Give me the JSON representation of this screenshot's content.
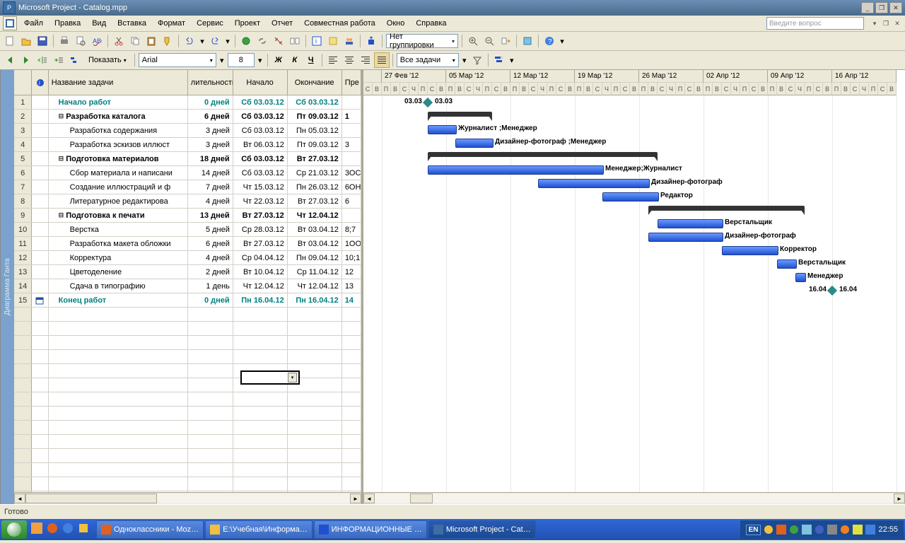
{
  "window": {
    "title": "Microsoft Project - Catalog.mpp"
  },
  "menu": {
    "items": [
      "Файл",
      "Правка",
      "Вид",
      "Вставка",
      "Формат",
      "Сервис",
      "Проект",
      "Отчет",
      "Совместная работа",
      "Окно",
      "Справка"
    ],
    "question": "Введите вопрос"
  },
  "toolbar": {
    "group_combo": "Нет группировки"
  },
  "toolbar2": {
    "show": "Показать",
    "font": "Arial",
    "size": "8",
    "filter": "Все задачи"
  },
  "grid": {
    "headers": [
      "",
      "",
      "Название задачи",
      "лительность",
      "Начало",
      "Окончание",
      "Пре"
    ],
    "rows": [
      {
        "n": "1",
        "ic": "",
        "name": "Начало работ",
        "dur": "0 дней",
        "start": "Сб 03.03.12",
        "end": "Сб 03.03.12",
        "pred": "",
        "bold": true,
        "teal": true,
        "indent": 1
      },
      {
        "n": "2",
        "ic": "",
        "name": "Разработка каталога",
        "dur": "6 дней",
        "start": "Сб 03.03.12",
        "end": "Пт 09.03.12",
        "pred": "1",
        "bold": true,
        "indent": 1,
        "outline": true
      },
      {
        "n": "3",
        "ic": "",
        "name": "Разработка содержания",
        "dur": "3 дней",
        "start": "Сб 03.03.12",
        "end": "Пн 05.03.12",
        "pred": "",
        "indent": 2
      },
      {
        "n": "4",
        "ic": "",
        "name": "Разработка эскизов иллюст",
        "dur": "3 дней",
        "start": "Вт 06.03.12",
        "end": "Пт 09.03.12",
        "pred": "3",
        "indent": 2
      },
      {
        "n": "5",
        "ic": "",
        "name": "Подготовка материалов",
        "dur": "18 дней",
        "start": "Сб 03.03.12",
        "end": "Вт 27.03.12",
        "pred": "",
        "bold": true,
        "indent": 1,
        "outline": true
      },
      {
        "n": "6",
        "ic": "",
        "name": "Сбор материала и написани",
        "dur": "14 дней",
        "start": "Сб 03.03.12",
        "end": "Ср 21.03.12",
        "pred": "3ОС",
        "indent": 2
      },
      {
        "n": "7",
        "ic": "",
        "name": "Создание иллюстраций и ф",
        "dur": "7 дней",
        "start": "Чт 15.03.12",
        "end": "Пн 26.03.12",
        "pred": "6ОН",
        "indent": 2
      },
      {
        "n": "8",
        "ic": "",
        "name": "Литературное редактирова",
        "dur": "4 дней",
        "start": "Чт 22.03.12",
        "end": "Вт 27.03.12",
        "pred": "6",
        "indent": 2
      },
      {
        "n": "9",
        "ic": "",
        "name": "Подготовка к печати",
        "dur": "13 дней",
        "start": "Вт 27.03.12",
        "end": "Чт 12.04.12",
        "pred": "",
        "bold": true,
        "indent": 1,
        "outline": true
      },
      {
        "n": "10",
        "ic": "",
        "name": "Верстка",
        "dur": "5 дней",
        "start": "Ср 28.03.12",
        "end": "Вт 03.04.12",
        "pred": "8;7",
        "indent": 2
      },
      {
        "n": "11",
        "ic": "",
        "name": "Разработка макета обложки",
        "dur": "6 дней",
        "start": "Вт 27.03.12",
        "end": "Вт 03.04.12",
        "pred": "1ОО",
        "indent": 2
      },
      {
        "n": "12",
        "ic": "",
        "name": "Корректура",
        "dur": "4 дней",
        "start": "Ср 04.04.12",
        "end": "Пн 09.04.12",
        "pred": "10;1",
        "indent": 2
      },
      {
        "n": "13",
        "ic": "",
        "name": "Цветоделение",
        "dur": "2 дней",
        "start": "Вт 10.04.12",
        "end": "Ср 11.04.12",
        "pred": "12",
        "indent": 2
      },
      {
        "n": "14",
        "ic": "",
        "name": "Сдача в типографию",
        "dur": "1 день",
        "start": "Чт 12.04.12",
        "end": "Чт 12.04.12",
        "pred": "13",
        "indent": 2
      },
      {
        "n": "15",
        "ic": "cal",
        "name": "Конец работ",
        "dur": "0 дней",
        "start": "Пн 16.04.12",
        "end": "Пн 16.04.12",
        "pred": "14",
        "bold": true,
        "teal": true,
        "indent": 1
      }
    ],
    "emptyrows": 15
  },
  "sidebar": {
    "label": "Диаграмма Ганта"
  },
  "timeline": {
    "weeks": [
      "27 Фев '12",
      "05 Мар '12",
      "12 Мар '12",
      "19 Мар '12",
      "26 Мар '12",
      "02 Апр '12",
      "09 Апр '12",
      "16 Апр '12"
    ],
    "daylabels": [
      "С",
      "В",
      "П",
      "В",
      "С",
      "Ч",
      "П",
      "С",
      "В",
      "П",
      "В",
      "С",
      "Ч",
      "П",
      "С",
      "В",
      "П",
      "В",
      "С",
      "Ч",
      "П",
      "С",
      "В",
      "П",
      "В",
      "С",
      "Ч",
      "П",
      "С",
      "В",
      "П",
      "В",
      "С",
      "Ч",
      "П",
      "С",
      "В",
      "П",
      "В",
      "С",
      "Ч",
      "П",
      "С",
      "В",
      "П",
      "В",
      "С",
      "Ч",
      "П",
      "С",
      "В",
      "П",
      "В",
      "С",
      "Ч",
      "П",
      "С",
      "В"
    ],
    "partial_first": 2
  },
  "gantt": {
    "labels": {
      "m1a": "03.03",
      "m1b": "03.03",
      "r3": "Журналист ;Менеджер",
      "r4": "Дизайнер-фотограф ;Менеджер",
      "r6": "Менеджер;Журналист",
      "r7": "Дизайнер-фотограф",
      "r8": "Редактор",
      "r10": "Верстальщик",
      "r11": "Дизайнер-фотограф",
      "r12": "Корректор",
      "r13": "Верстальщик",
      "r14": "Менеджер",
      "m15a": "16.04",
      "m15b": "16.04"
    }
  },
  "status": {
    "text": "Готово"
  },
  "taskbar": {
    "buttons": [
      {
        "label": "Одноклассники - Moz…"
      },
      {
        "label": "E:\\Учебная\\Информа…"
      },
      {
        "label": "ИНФОРМАЦИОННЫЕ …"
      },
      {
        "label": "Microsoft Project - Cat…",
        "active": true
      }
    ],
    "lang": "EN",
    "clock": "22:55"
  }
}
